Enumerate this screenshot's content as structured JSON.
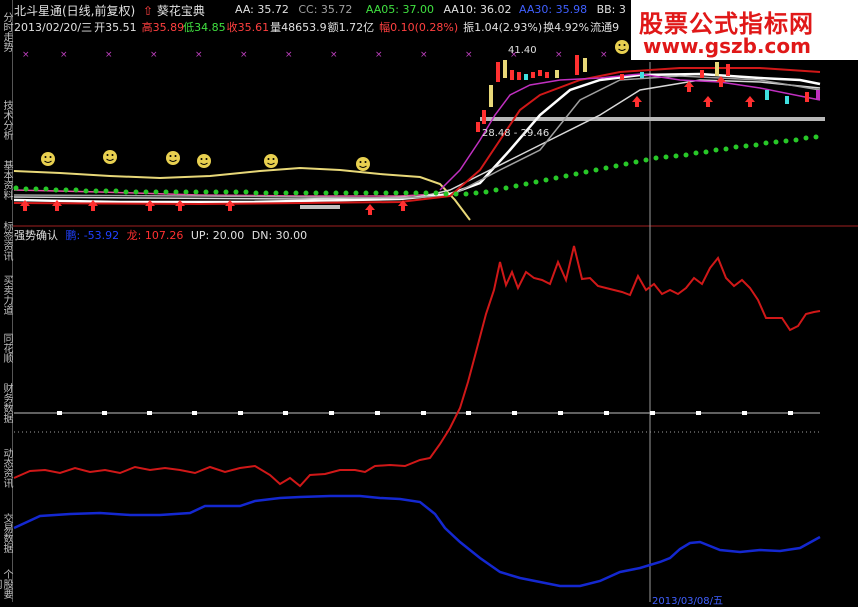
{
  "header": {
    "app_name": "北斗星通(日线,前复权)",
    "indicator_name": "葵花宝典",
    "aa": "AA: 35.72",
    "cc": "CC: 35.72",
    "aa05": "AA05: 37.00",
    "aa10": "AA10: 36.02",
    "aa30": "AA30: 35.98",
    "bb": "BB: 3"
  },
  "quote": {
    "date": "2013/02/20/三",
    "open": "开35.51",
    "high": "高35.89",
    "low": "低34.85",
    "close": "收35.61",
    "volume": "量48653.9",
    "amount": "额1.72亿",
    "change": "幅0.10(0.28%)",
    "amplitude": "振1.04(2.93%)",
    "turnover": "换4.92%",
    "float": "流通9"
  },
  "chart_labels": {
    "high_marker": "41.40",
    "range_marker": "28.48 - 29.46"
  },
  "indicator_panel": {
    "title": "强势确认",
    "tiger": "鹏: -53.92",
    "dragon": "龙: 107.26",
    "up": "UP: 20.00",
    "dn": "DN: 30.00"
  },
  "sidebar": {
    "items": [
      "分时走势",
      "技术分析",
      "基本资料",
      "标签资讯",
      "买卖力道",
      "同花顺",
      "财务数据",
      "动态资讯",
      "交易数据",
      "个股要闻"
    ]
  },
  "bottom_date": "2013/03/08/五",
  "watermark": {
    "title": "股票公式指标网",
    "url": "www.gszb.com"
  },
  "colors": {
    "red_line": "#d01818",
    "blue_line": "#1428d0",
    "yellow_line": "#e8d878",
    "green_dots": "#28c828",
    "accent_red": "#ff4040"
  }
}
